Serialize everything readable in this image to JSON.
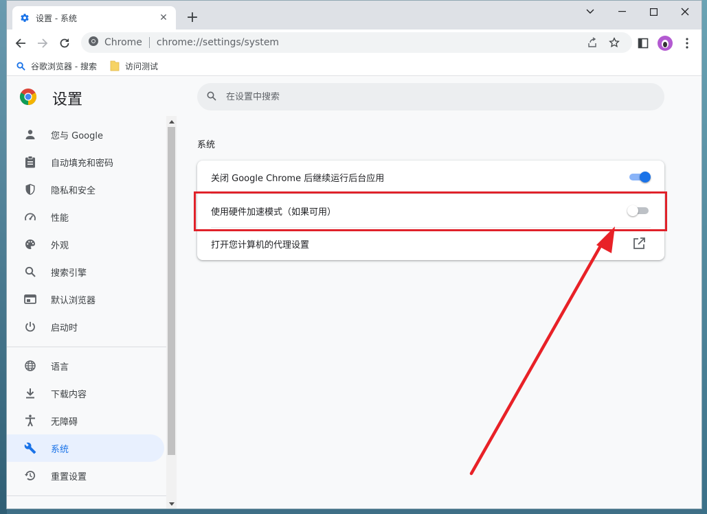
{
  "browser": {
    "tab_title": "设置 - 系统",
    "site_label": "Chrome",
    "url": "chrome://settings/system",
    "bookmarks": [
      {
        "label": "谷歌浏览器 - 搜索",
        "icon": "search-icon"
      },
      {
        "label": "访问测试",
        "icon": "folder-icon"
      }
    ]
  },
  "settings": {
    "title": "设置",
    "search_placeholder": "在设置中搜索",
    "sidebar": [
      {
        "label": "您与 Google",
        "icon": "person-icon"
      },
      {
        "label": "自动填充和密码",
        "icon": "clipboard-icon"
      },
      {
        "label": "隐私和安全",
        "icon": "shield-icon"
      },
      {
        "label": "性能",
        "icon": "speedometer-icon"
      },
      {
        "label": "外观",
        "icon": "palette-icon"
      },
      {
        "label": "搜索引擎",
        "icon": "search-icon"
      },
      {
        "label": "默认浏览器",
        "icon": "browser-icon"
      },
      {
        "label": "启动时",
        "icon": "power-icon"
      },
      {
        "label": "语言",
        "icon": "globe-icon"
      },
      {
        "label": "下载内容",
        "icon": "download-icon"
      },
      {
        "label": "无障碍",
        "icon": "accessibility-icon"
      },
      {
        "label": "系统",
        "icon": "wrench-icon",
        "active": true
      },
      {
        "label": "重置设置",
        "icon": "reset-icon"
      }
    ],
    "section_title": "系统",
    "rows": [
      {
        "label": "关闭 Google Chrome 后继续运行后台应用",
        "control": "toggle",
        "on": true
      },
      {
        "label": "使用硬件加速模式（如果可用）",
        "control": "toggle",
        "on": false
      },
      {
        "label": "打开您计算机的代理设置",
        "control": "external-link-icon"
      }
    ]
  },
  "colors": {
    "accent": "#1a73e8",
    "annotation_red": "#e0222a"
  }
}
